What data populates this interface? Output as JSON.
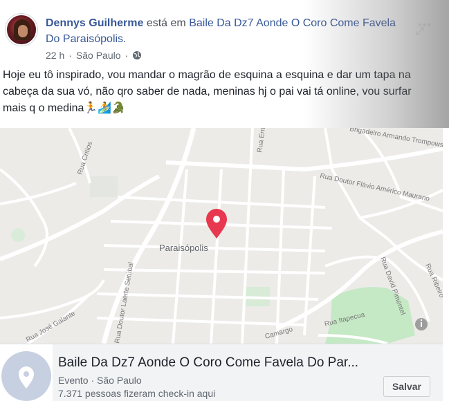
{
  "post": {
    "author": "Dennys Guilherme",
    "connector": " está em ",
    "place": "Baile Da Dz7 Aonde O Coro Come Favela Do Paraisópolis.",
    "time": "22 h",
    "location": "São Paulo",
    "separator": "·",
    "text": "Hoje eu tô inspirado, vou mandar o magrão de esquina a esquina e dar um tapa na cabeça da sua vó, não qro saber de nada, meninas hj o pai vai tá online, vou surfar mais q o medina🏃🏄🐊"
  },
  "map": {
    "center_label": "Paraisópolis",
    "streets": {
      "critios": "Rua Critios",
      "ern": "Rua Ern",
      "brigadeiro": "Brigadeiro Armando Trompowsk",
      "flavio": "Rua Doutor Flávio Américo Maurano",
      "setubal": "Rua Doutor Laerte Setúbal",
      "galante": "Rua José Galante",
      "pimentel": "Rua David Pimentel",
      "itapecua": "Rua Itapecua",
      "camargo": "Camargo",
      "ribeiro": "Rua Ribeiro"
    },
    "pin_color": "#e8384f"
  },
  "card": {
    "title": "Baile Da Dz7 Aonde O Coro Come Favela Do Par...",
    "category": "Evento",
    "separator": "·",
    "location": "São Paulo",
    "checkins": "7.371 pessoas fizeram check-in aqui",
    "save_label": "Salvar"
  },
  "colors": {
    "link": "#385898",
    "map_land": "#ecebe8",
    "map_park": "#c5e8c5",
    "map_road": "#ffffff"
  }
}
